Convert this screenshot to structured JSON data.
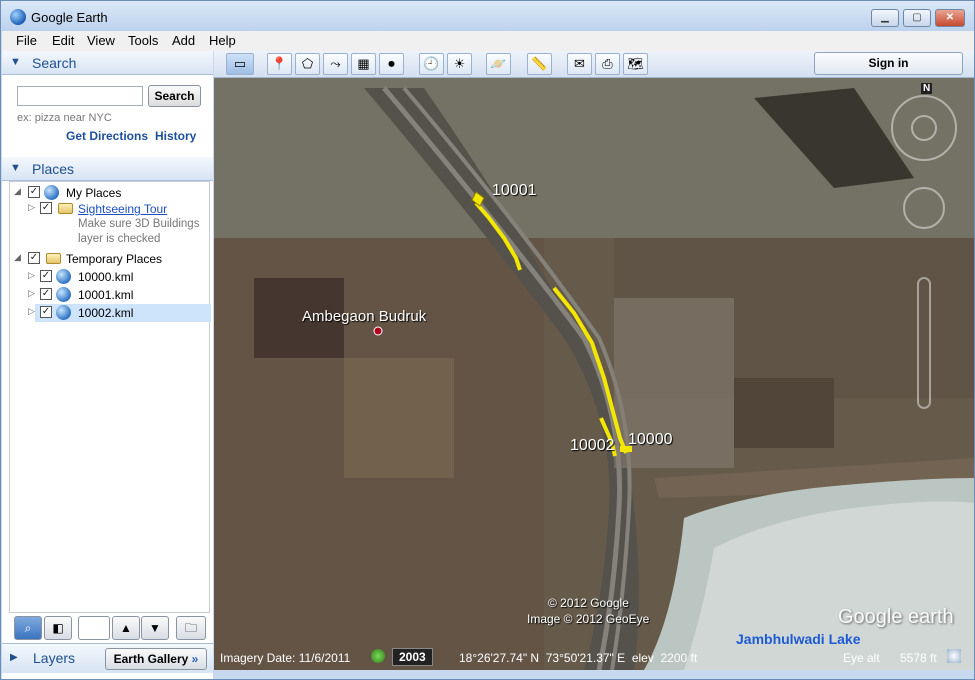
{
  "window": {
    "title": "Google Earth"
  },
  "menu": [
    "File",
    "Edit",
    "View",
    "Tools",
    "Add",
    "Help"
  ],
  "search": {
    "header": "Search",
    "placeholder": "",
    "button": "Search",
    "hint": "ex: pizza near NYC",
    "get_directions": "Get Directions",
    "history": "History"
  },
  "places": {
    "header": "Places",
    "my_places": "My Places",
    "sightseeing": "Sightseeing Tour",
    "sightseeing_note": "Make sure 3D Buildings layer is checked",
    "temporary": "Temporary Places",
    "files": [
      "10000.kml",
      "10001.kml",
      "10002.kml"
    ]
  },
  "layers": {
    "header": "Layers",
    "gallery": "Earth Gallery",
    "gallery_arrow": "»"
  },
  "toolbar": {
    "sign_in": "Sign in"
  },
  "map": {
    "place_label": "Ambegaon Budruk",
    "markers": [
      "10001",
      "10002",
      "10000"
    ],
    "lake_label": "Jambhulwadi Lake",
    "copyright1": "© 2012 Google",
    "copyright2": "Image © 2012 GeoEye",
    "watermark": "Google earth",
    "compass_n": "N"
  },
  "status": {
    "imagery_date": "Imagery Date: 11/6/2011",
    "year": "2003",
    "coords": "18°26'27.74\" N  73°50'21.37\" E  elev  2200 ft",
    "eye_alt_label": "Eye alt",
    "eye_alt": "5578 ft"
  },
  "colors": {
    "track": "#f3e600",
    "accent": "#1f4f8f"
  }
}
